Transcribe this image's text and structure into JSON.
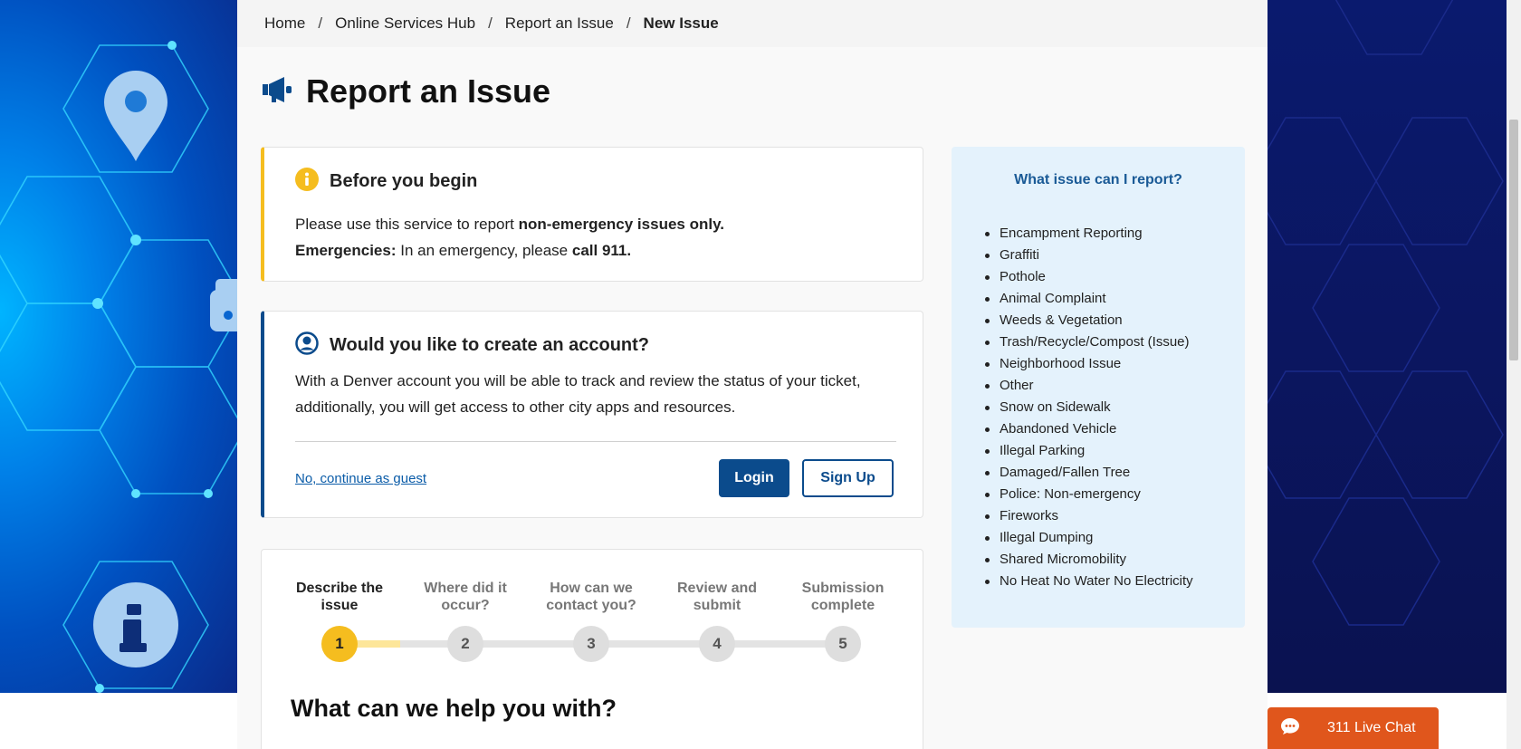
{
  "breadcrumb": {
    "items": [
      "Home",
      "Online Services Hub",
      "Report an Issue"
    ],
    "current": "New Issue",
    "separator": "/"
  },
  "page": {
    "title": "Report an Issue",
    "title_icon": "megaphone-icon"
  },
  "notice": {
    "icon": "info-circle-icon",
    "heading": "Before you begin",
    "line1_prefix": "Please use this service to report ",
    "line1_bold": "non-emergency issues only.",
    "line2_bold_prefix": "Emergencies:",
    "line2_text": " In an emergency, please ",
    "line2_bold_suffix": "call 911."
  },
  "account": {
    "icon": "user-circle-icon",
    "heading": "Would you like to create an account?",
    "body_line1": "With a Denver account you will be able to track and review the status of your ticket,",
    "body_line2": "additionally, you will get access to other city apps and resources.",
    "guest_link": "No, continue as guest",
    "login_label": "Login",
    "signup_label": "Sign Up"
  },
  "steps": {
    "items": [
      {
        "line1": "Describe the",
        "line2": "issue",
        "number": "1",
        "active": true
      },
      {
        "line1": "Where did it",
        "line2": "occur?",
        "number": "2",
        "active": false
      },
      {
        "line1": "How can we",
        "line2": "contact you?",
        "number": "3",
        "active": false
      },
      {
        "line1": "Review and",
        "line2": "submit",
        "number": "4",
        "active": false
      },
      {
        "line1": "Submission",
        "line2": "complete",
        "number": "5",
        "active": false
      }
    ],
    "progress_fraction": 0.12
  },
  "help": {
    "title": "What can we help you with?"
  },
  "sidebar": {
    "title": "What issue can I report?",
    "items": [
      "Encampment Reporting",
      "Graffiti",
      "Pothole",
      "Animal Complaint",
      "Weeds & Vegetation",
      "Trash/Recycle/Compost (Issue)",
      "Neighborhood Issue",
      "Other",
      "Snow on Sidewalk",
      "Abandoned Vehicle",
      "Illegal Parking",
      "Damaged/Fallen Tree",
      "Police: Non-emergency",
      "Fireworks",
      "Illegal Dumping",
      "Shared Micromobility",
      "No Heat No Water No Electricity"
    ]
  },
  "chat": {
    "label": "311 Live Chat",
    "icon": "chat-bubble-icon"
  },
  "colors": {
    "primary": "#0b4b8c",
    "accent_yellow": "#f5bd1f",
    "chat_orange": "#e0561c",
    "sidebar_bg": "#e4f2fc"
  }
}
